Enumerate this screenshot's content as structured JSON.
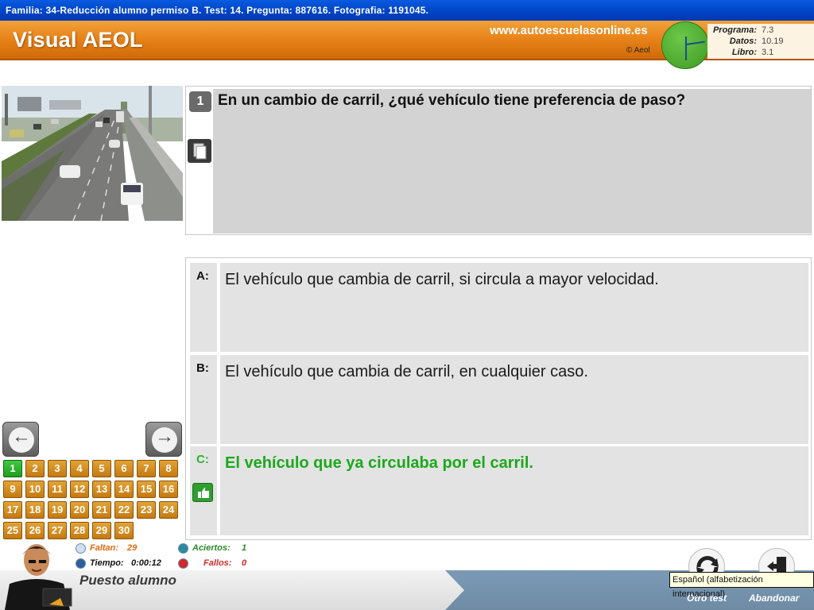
{
  "window": {
    "title": "Familia: 34-Reducción alumno permiso B. Test: 14. Pregunta: 887616. Fotografia: 1191045."
  },
  "header": {
    "logo": "Visual AEOL",
    "site": "www.autoescuelasonline.es",
    "copyright": "© Aeol",
    "versions": [
      {
        "label": "Programa:",
        "value": "7.3"
      },
      {
        "label": "Datos:",
        "value": "10.19"
      },
      {
        "label": "Libro:",
        "value": "3.1"
      }
    ]
  },
  "question": {
    "number": "1",
    "text": "En un cambio de carril, ¿qué vehículo tiene preferencia de paso?"
  },
  "answers": [
    {
      "letter": "A:",
      "text": "El vehículo que cambia de carril, si circula a mayor velocidad."
    },
    {
      "letter": "B:",
      "text": "El vehículo que cambia de carril, en cualquier caso."
    },
    {
      "letter": "C:",
      "text": "El vehículo que ya circulaba por el carril."
    }
  ],
  "numbers": [
    "1",
    "2",
    "3",
    "4",
    "5",
    "6",
    "7",
    "8",
    "9",
    "10",
    "11",
    "12",
    "13",
    "14",
    "15",
    "16",
    "17",
    "18",
    "19",
    "20",
    "21",
    "22",
    "23",
    "24",
    "25",
    "26",
    "27",
    "28",
    "29",
    "30"
  ],
  "stats": {
    "faltan_label": "Faltan:",
    "faltan_value": "29",
    "tiempo_label": "Tiempo:",
    "tiempo_value": "0:00:12",
    "aciertos_label": "Aciertos:",
    "aciertos_value": "1",
    "fallos_label": "Fallos:",
    "fallos_value": "0"
  },
  "footer": {
    "puesto": "Puesto alumno",
    "otro_test": "Otro test",
    "abandonar": "Abandonar",
    "tooltip": "Español (alfabetización internacional)"
  },
  "colors": {
    "titlebar": "#0046c8",
    "header": "#e8841a",
    "correct": "#1ba81b",
    "number_button": "#d98c1f",
    "number_active": "#2fb22f"
  }
}
